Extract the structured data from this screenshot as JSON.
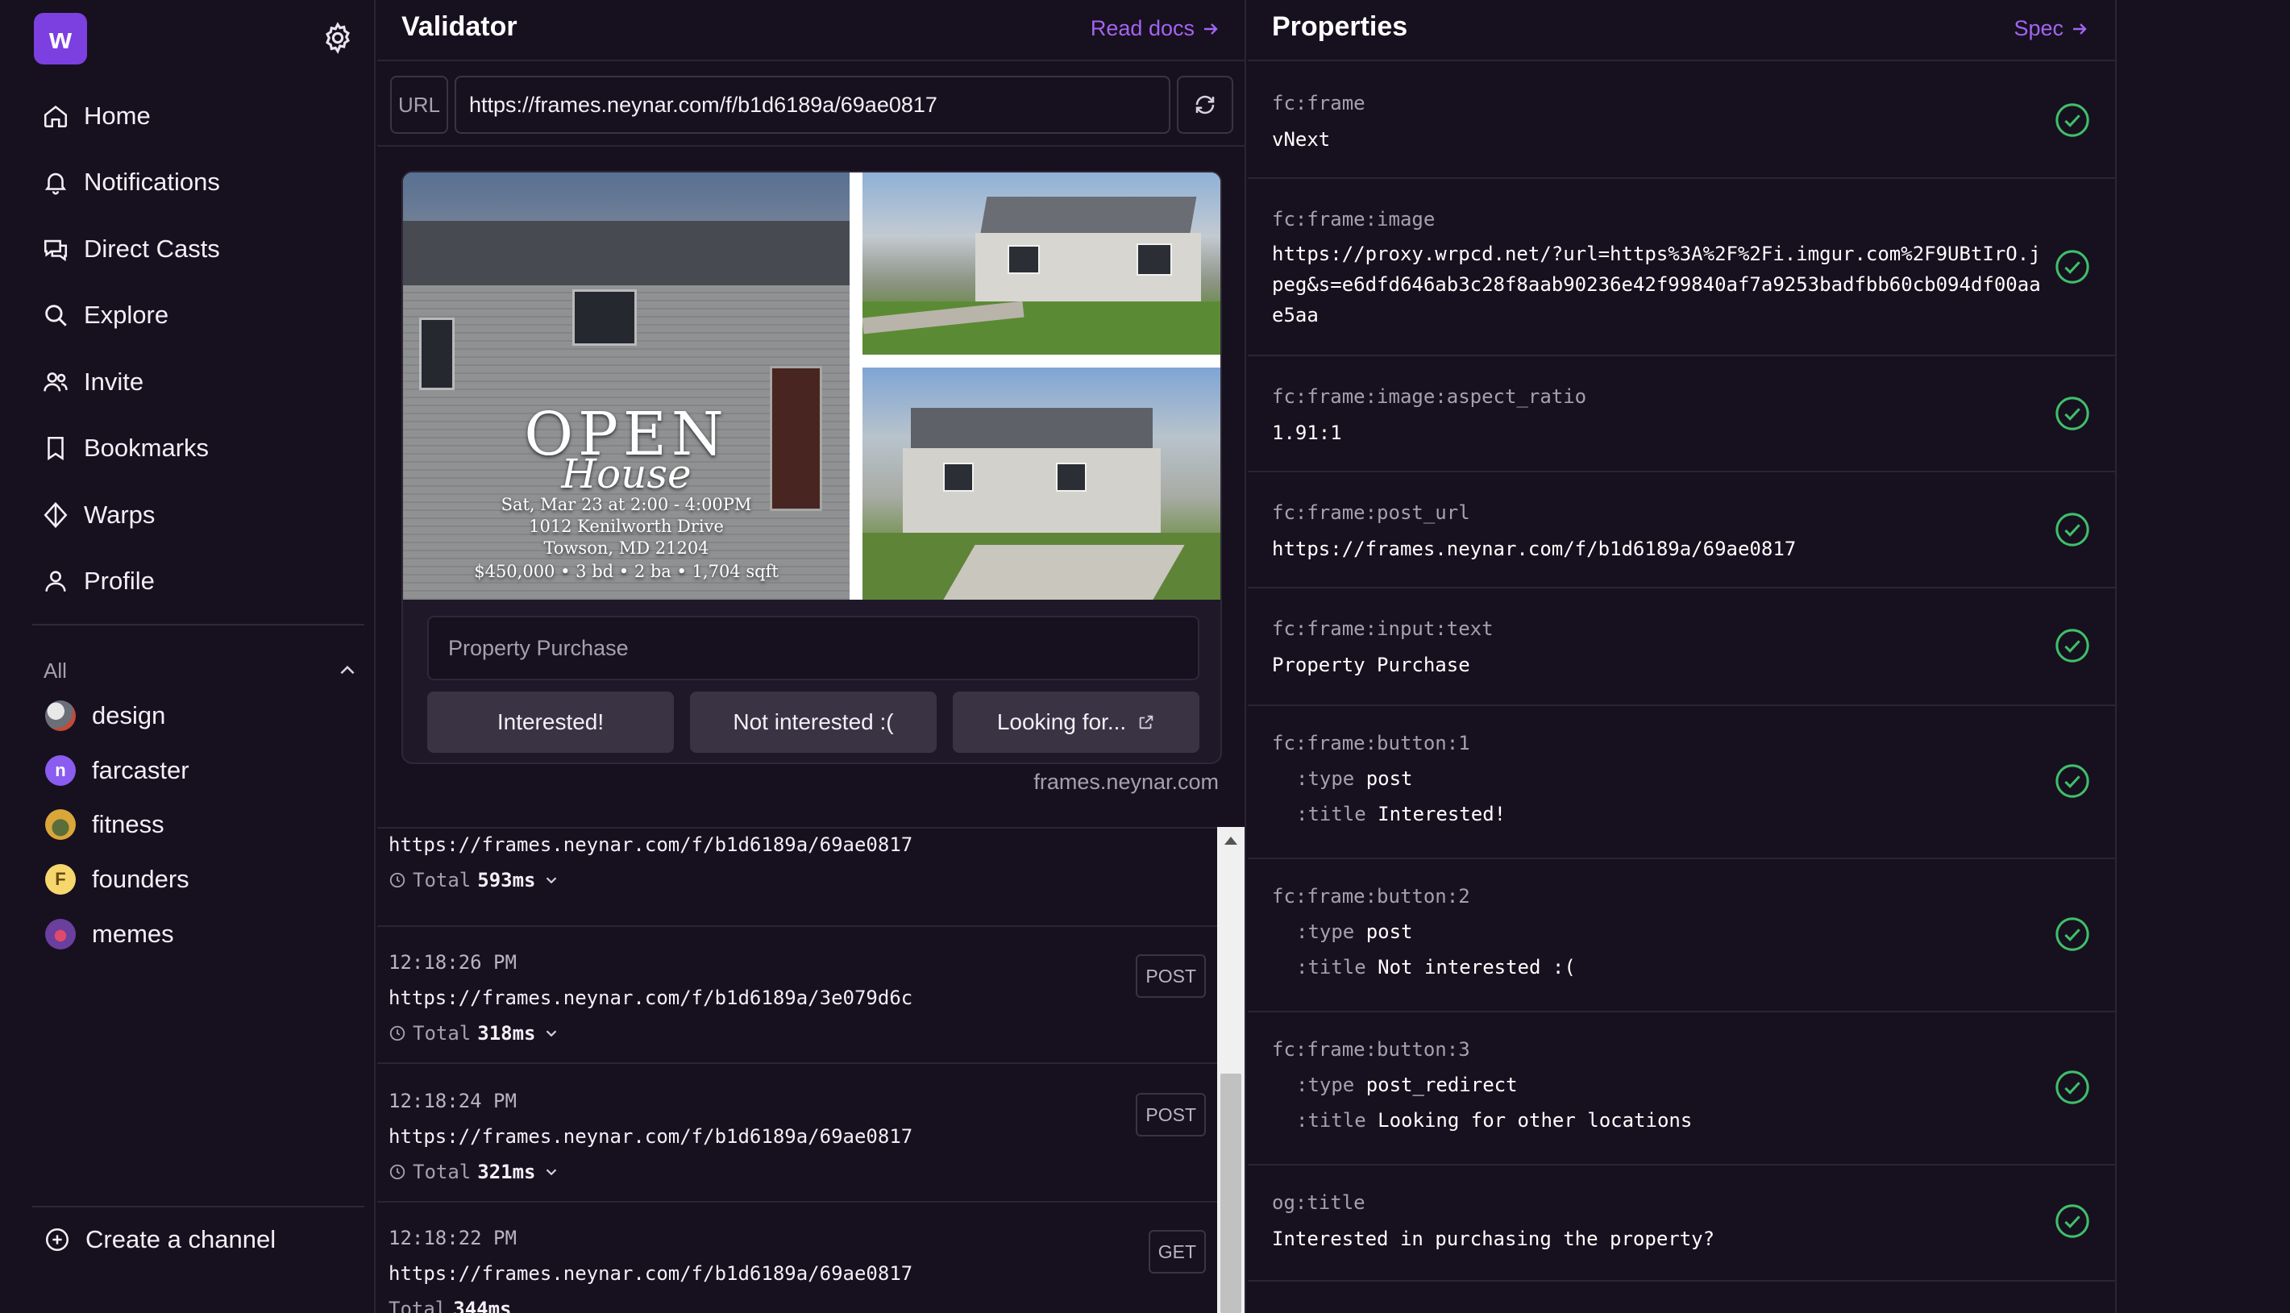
{
  "sidebar": {
    "logo_letter": "w",
    "nav": [
      {
        "label": "Home",
        "icon": "home-icon"
      },
      {
        "label": "Notifications",
        "icon": "bell-icon"
      },
      {
        "label": "Direct Casts",
        "icon": "chat-icon"
      },
      {
        "label": "Explore",
        "icon": "search-icon"
      },
      {
        "label": "Invite",
        "icon": "users-icon"
      },
      {
        "label": "Bookmarks",
        "icon": "bookmark-icon"
      },
      {
        "label": "Warps",
        "icon": "diamond-icon"
      },
      {
        "label": "Profile",
        "icon": "user-icon"
      }
    ],
    "channels_header": "All",
    "channels": [
      {
        "name": "design",
        "avatar_color": "#8a8f98"
      },
      {
        "name": "farcaster",
        "avatar_color": "#8a5cf0",
        "avatar_text": "n"
      },
      {
        "name": "fitness",
        "avatar_color": "#d9a63a"
      },
      {
        "name": "founders",
        "avatar_color": "#f5d76e",
        "avatar_text": "F"
      },
      {
        "name": "memes",
        "avatar_color": "#6a3f9e"
      }
    ],
    "create_channel": "Create a channel"
  },
  "validator": {
    "title": "Validator",
    "read_docs": "Read docs",
    "url_label": "URL",
    "url_value": "https://frames.neynar.com/f/b1d6189a/69ae0817",
    "frame": {
      "overlay_big": "OPEN",
      "overlay_script": "House",
      "overlay_lines": [
        "Sat, Mar 23 at 2:00 - 4:00PM",
        "1012 Kenilworth Drive",
        "Towson, MD 21204",
        "$450,000 • 3 bd • 2 ba • 1,704 sqft"
      ],
      "input_placeholder": "Property Purchase",
      "buttons": [
        "Interested!",
        "Not interested :(",
        "Looking for..."
      ],
      "domain": "frames.neynar.com"
    },
    "log": [
      {
        "time": "",
        "url": "https://frames.neynar.com/f/b1d6189a/69ae0817",
        "total_label": "Total",
        "total": "593ms",
        "method": ""
      },
      {
        "time": "12:18:26 PM",
        "url": "https://frames.neynar.com/f/b1d6189a/3e079d6c",
        "total_label": "Total",
        "total": "318ms",
        "method": "POST"
      },
      {
        "time": "12:18:24 PM",
        "url": "https://frames.neynar.com/f/b1d6189a/69ae0817",
        "total_label": "Total",
        "total": "321ms",
        "method": "POST"
      },
      {
        "time": "12:18:22 PM",
        "url": "https://frames.neynar.com/f/b1d6189a/69ae0817",
        "total_label": "Total",
        "total": "344ms",
        "method": "GET"
      }
    ]
  },
  "properties": {
    "title": "Properties",
    "spec": "Spec",
    "items": [
      {
        "key": "fc:frame",
        "value": "vNext"
      },
      {
        "key": "fc:frame:image",
        "value": "https://proxy.wrpcd.net/?url=https%3A%2F%2Fi.imgur.com%2F9UBtIrO.jpeg&s=e6dfd646ab3c28f8aab90236e42f99840af7a9253badfbb60cb094df00aae5aa"
      },
      {
        "key": "fc:frame:image:aspect_ratio",
        "value": "1.91:1"
      },
      {
        "key": "fc:frame:post_url",
        "value": "https://frames.neynar.com/f/b1d6189a/69ae0817"
      },
      {
        "key": "fc:frame:input:text",
        "value": "Property Purchase"
      },
      {
        "key": "fc:frame:button:1",
        "type_label": ":type",
        "type": "post",
        "title_label": ":title",
        "title": "Interested!"
      },
      {
        "key": "fc:frame:button:2",
        "type_label": ":type",
        "type": "post",
        "title_label": ":title",
        "title": "Not interested :("
      },
      {
        "key": "fc:frame:button:3",
        "type_label": ":type",
        "type": "post_redirect",
        "title_label": ":title",
        "title": "Looking for other locations"
      },
      {
        "key": "og:title",
        "value": "Interested in purchasing the property?"
      }
    ]
  },
  "colors": {
    "accent": "#a265ef",
    "check": "#3fbf6a",
    "brand": "#7c3fe0"
  }
}
